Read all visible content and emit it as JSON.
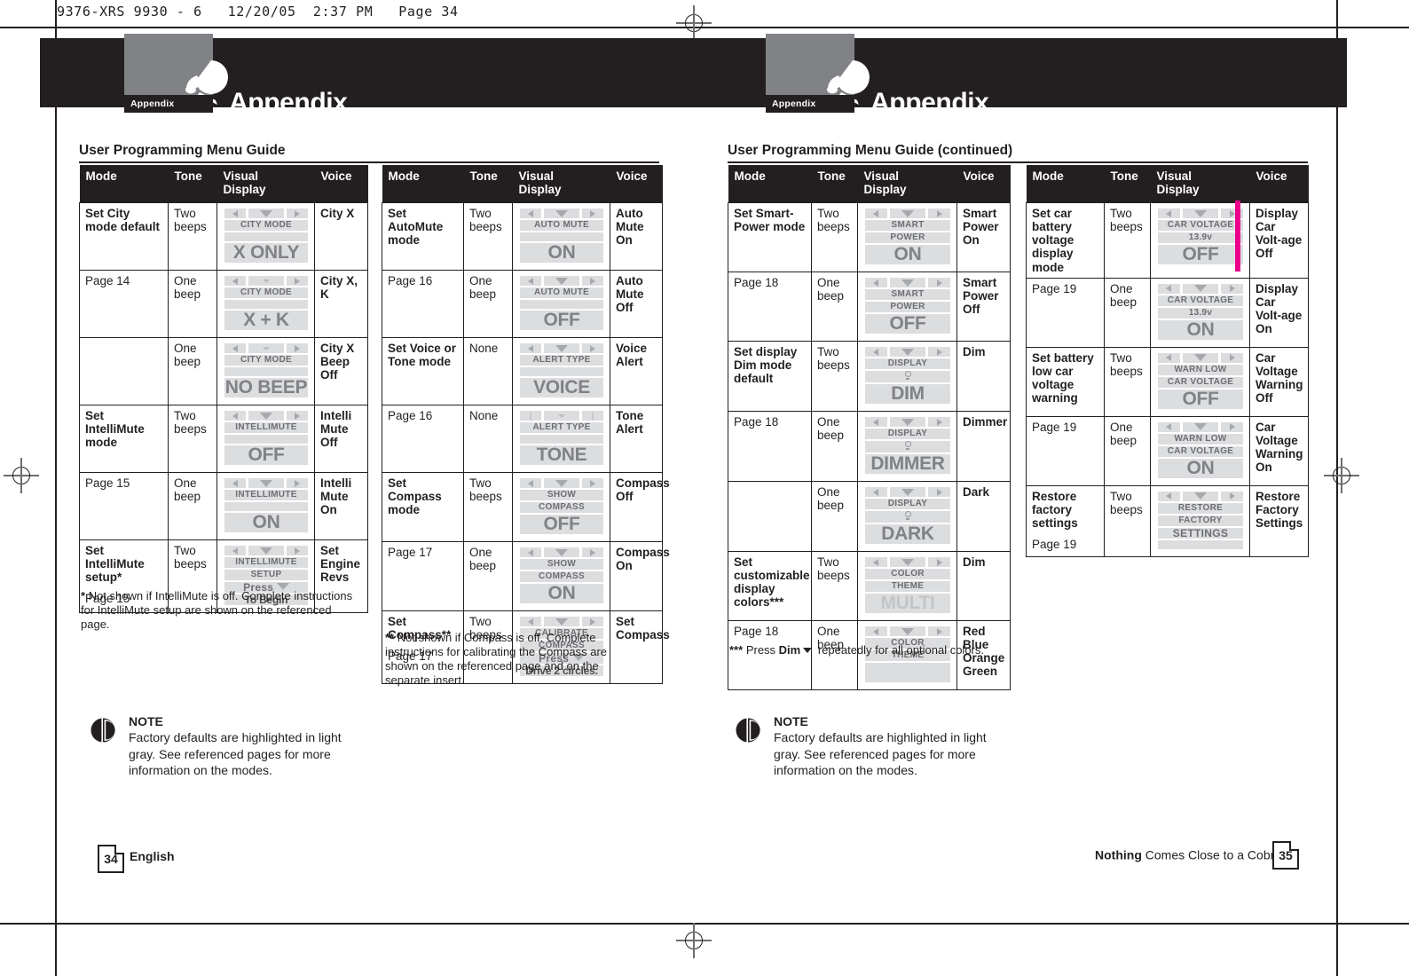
{
  "slug": "9376-XRS 9930 - 6   12/20/05  2:37 PM   Page 34",
  "banner": {
    "tab_label": "Appendix",
    "title": "Appendix"
  },
  "left_page": {
    "heading": "User Programming Menu Guide",
    "columns": [
      "Mode",
      "Tone",
      "Visual\nDisplay",
      "Voice"
    ],
    "col_mode": "Mode",
    "col_tone": "Tone",
    "col_visual_1": "Visual",
    "col_visual_2": "Display",
    "col_voice": "Voice",
    "footer_page": "34",
    "footer_label": "English"
  },
  "right_page": {
    "heading": "User Programming Menu Guide (continued)",
    "footer_page": "35",
    "tagline_bold": "Nothing",
    "tagline_rest": " Comes Close to a Cobra",
    "tagline_reg": "®"
  },
  "table1": {
    "groups": [
      {
        "mode": "Set City mode default",
        "page": "Page 14",
        "rows": [
          {
            "tone": "Two beeps",
            "lcd": {
              "arrows": "full",
              "l1": "CITY MODE",
              "l2": "",
              "big": "X ONLY"
            },
            "voice": "City X",
            "hl": true
          },
          {
            "tone": "One beep",
            "lcd": {
              "arrows": "small",
              "l1": "CITY MODE",
              "l2": "",
              "big": "X + K"
            },
            "voice": "City X, K",
            "hl": false
          },
          {
            "tone": "One beep",
            "lcd": {
              "arrows": "small",
              "l1": "CITY MODE",
              "l2": "",
              "big": "NO BEEP"
            },
            "voice": "City X Beep Off",
            "hl": false
          }
        ]
      },
      {
        "mode": "Set IntelliMute mode",
        "page": "Page 15",
        "rows": [
          {
            "tone": "Two beeps",
            "lcd": {
              "arrows": "full",
              "l1": "INTELLIMUTE",
              "l2": "",
              "big": "OFF"
            },
            "voice": "Intelli Mute Off",
            "hl": true
          },
          {
            "tone": "One beep",
            "lcd": {
              "arrows": "full",
              "l1": "INTELLIMUTE",
              "l2": "",
              "big": "ON"
            },
            "voice": "Intelli Mute On",
            "hl": false
          }
        ]
      },
      {
        "mode": "Set IntelliMute setup*",
        "page": "Page 15",
        "rows": [
          {
            "tone": "Two beeps",
            "lcd": {
              "arrows": "full",
              "l1": "INTELLIMUTE",
              "l2": "SETUP",
              "l3": "Press",
              "l4": "To Begin"
            },
            "voice": "Set Engine Revs",
            "hl": false
          }
        ]
      }
    ]
  },
  "table2": {
    "groups": [
      {
        "mode": "Set AutoMute mode",
        "page": "Page 16",
        "rows": [
          {
            "tone": "Two beeps",
            "lcd": {
              "arrows": "full",
              "l1": "AUTO MUTE",
              "l2": "",
              "big": "ON"
            },
            "voice": "Auto Mute On",
            "hl": true
          },
          {
            "tone": "One beep",
            "lcd": {
              "arrows": "full",
              "l1": "AUTO MUTE",
              "l2": "",
              "big": "OFF"
            },
            "voice": "Auto Mute Off",
            "hl": false
          }
        ]
      },
      {
        "mode": "Set Voice or Tone mode",
        "page": "Page 16",
        "rows": [
          {
            "tone": "None",
            "lcd": {
              "arrows": "full",
              "l1": "ALERT TYPE",
              "l2": "",
              "big": "VOICE"
            },
            "voice": "Voice Alert",
            "hl": true
          },
          {
            "tone": "None",
            "lcd": {
              "arrows": "pipes",
              "l1": "ALERT TYPE",
              "l2": "",
              "big": "TONE"
            },
            "voice": "Tone Alert",
            "hl": false
          }
        ]
      },
      {
        "mode": "Set Compass mode",
        "page": "Page 17",
        "rows": [
          {
            "tone": "Two beeps",
            "lcd": {
              "arrows": "full",
              "l1": "SHOW",
              "l2": "COMPASS",
              "big": "OFF"
            },
            "voice": "Compass Off",
            "hl": true
          },
          {
            "tone": "One beep",
            "lcd": {
              "arrows": "full",
              "l1": "SHOW",
              "l2": "COMPASS",
              "big": "ON"
            },
            "voice": "Compass On",
            "hl": false
          }
        ]
      },
      {
        "mode": "Set Compass**",
        "page": "Page 17",
        "rows": [
          {
            "tone": "Two beeps",
            "lcd": {
              "arrows": "full",
              "l1": "CALIBRATE",
              "l2": "COMPASS",
              "l3": "Press",
              "l4": "Drive 2 circles."
            },
            "voice": "Set Compass",
            "hl": false
          }
        ]
      }
    ]
  },
  "table3": {
    "groups": [
      {
        "mode": "Set Smart-Power mode",
        "page": "Page 18",
        "rows": [
          {
            "tone": "Two beeps",
            "lcd": {
              "arrows": "full",
              "l1": "SMART",
              "l2": "POWER",
              "big": "ON"
            },
            "voice": "Smart Power On",
            "hl": true
          },
          {
            "tone": "One beep",
            "lcd": {
              "arrows": "full",
              "l1": "SMART",
              "l2": "POWER",
              "big": "OFF"
            },
            "voice": "Smart Power Off",
            "hl": false
          }
        ]
      },
      {
        "mode": "Set display Dim mode default",
        "page": "Page 18",
        "rows": [
          {
            "tone": "Two beeps",
            "lcd": {
              "arrows": "full",
              "l1": "DISPLAY",
              "l2": "bulb",
              "big": "DIM"
            },
            "voice": "Dim",
            "hl": true
          },
          {
            "tone": "One beep",
            "lcd": {
              "arrows": "full",
              "l1": "DISPLAY",
              "l2": "bulb",
              "big": "DIMMER"
            },
            "voice": "Dimmer",
            "hl": false
          },
          {
            "tone": "One beep",
            "lcd": {
              "arrows": "full",
              "l1": "DISPLAY",
              "l2": "bulb",
              "big": "DARK"
            },
            "voice": "Dark",
            "hl": false
          }
        ]
      },
      {
        "mode": "Set customizable display colors***",
        "page": "Page 18",
        "rows": [
          {
            "tone": "Two beeps",
            "lcd": {
              "arrows": "full",
              "l1": "COLOR",
              "l2": "THEME",
              "big": "MULTI",
              "pale": true
            },
            "voice": "Dim",
            "hl": true
          },
          {
            "tone": "One beep",
            "lcd": {
              "arrows": "full",
              "l1": "COLOR",
              "l2": "THEME",
              "big": ""
            },
            "voice": "Red Blue Orange Green",
            "hl": false
          }
        ]
      }
    ]
  },
  "table4": {
    "groups": [
      {
        "mode": "Set car battery voltage display mode",
        "page": "Page 19",
        "rows": [
          {
            "tone": "Two beeps",
            "lcd": {
              "arrows": "full",
              "l1": "CAR VOLTAGE",
              "l2": "13.9v",
              "big": "OFF"
            },
            "voice": "Display Car Volt-age Off",
            "hl": true
          },
          {
            "tone": "One beep",
            "lcd": {
              "arrows": "full",
              "l1": "CAR VOLTAGE",
              "l2": "13.9v",
              "big": "ON"
            },
            "voice": "Display Car Volt-age On",
            "hl": false
          }
        ]
      },
      {
        "mode": "Set battery low car voltage warning",
        "page": "Page 19",
        "rows": [
          {
            "tone": "Two beeps",
            "lcd": {
              "arrows": "full",
              "l1": "WARN LOW",
              "l2": "CAR VOLTAGE",
              "big": "OFF"
            },
            "voice": "Car Voltage Warning Off",
            "hl": true
          },
          {
            "tone": "One beep",
            "lcd": {
              "arrows": "full",
              "l1": "WARN LOW",
              "l2": "CAR VOLTAGE",
              "big": "ON"
            },
            "voice": "Car Voltage Warning On",
            "hl": false
          }
        ]
      },
      {
        "mode": "Restore factory settings",
        "page": "Page 19",
        "rows": [
          {
            "tone": "Two beeps",
            "lcd": {
              "arrows": "full",
              "l1": "RESTORE",
              "l2": "FACTORY",
              "l3": "SETTINGS",
              "l4": ""
            },
            "voice": "Restore Factory Settings",
            "hl": false
          }
        ]
      }
    ]
  },
  "footnotes": {
    "one_mark": "*",
    "one_text": "Not shown if IntelliMute is off. Complete instructions for IntelliMute setup are shown on the referenced page.",
    "two_mark": "**",
    "two_text": "Not shown if Compass is off. Complete instructions for calibrating the Compass are shown on the referenced page and on the separate insert.",
    "three_mark": "***",
    "three_pre": "Press ",
    "three_bold": "Dim",
    "three_post": " repeatedly for all optional colors."
  },
  "note": {
    "title": "NOTE",
    "body": "Factory defaults are highlighted in light gray. See referenced pages for more information on the modes."
  },
  "colors": {
    "ink": "#231f20",
    "lcd_gray": "#dcdddf",
    "highlight": "#e2e3e5",
    "magenta": "#ec008c",
    "banner_box": "#808285"
  }
}
